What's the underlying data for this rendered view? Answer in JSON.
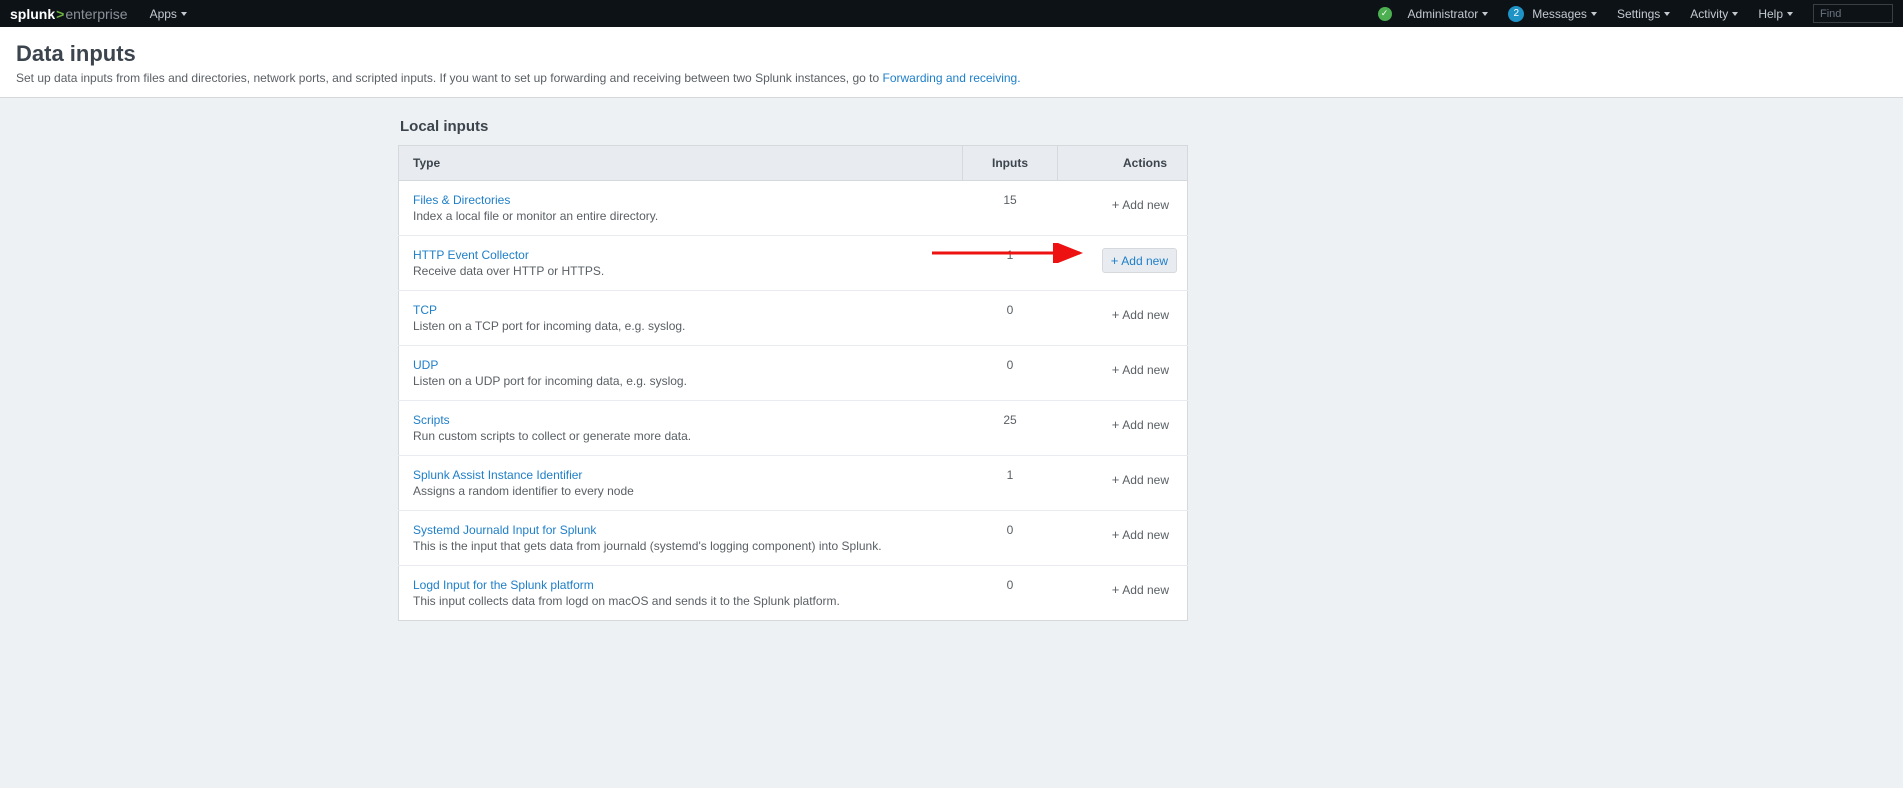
{
  "topbar": {
    "logo_part1": "splunk",
    "logo_part2": "enterprise",
    "apps": "Apps",
    "administrator": "Administrator",
    "messages_label": "Messages",
    "messages_count": "2",
    "settings": "Settings",
    "activity": "Activity",
    "help": "Help",
    "find_placeholder": "Find"
  },
  "header": {
    "title": "Data inputs",
    "subtitle_prefix": "Set up data inputs from files and directories, network ports, and scripted inputs. If you want to set up forwarding and receiving between two Splunk instances, go to ",
    "subtitle_link": "Forwarding and receiving."
  },
  "section": {
    "title": "Local inputs"
  },
  "columns": {
    "type": "Type",
    "inputs": "Inputs",
    "actions": "Actions"
  },
  "add_new_label": "Add new",
  "rows": [
    {
      "name": "Files & Directories",
      "desc": "Index a local file or monitor an entire directory.",
      "count": "15",
      "highlighted": false
    },
    {
      "name": "HTTP Event Collector",
      "desc": "Receive data over HTTP or HTTPS.",
      "count": "1",
      "highlighted": true
    },
    {
      "name": "TCP",
      "desc": "Listen on a TCP port for incoming data, e.g. syslog.",
      "count": "0",
      "highlighted": false
    },
    {
      "name": "UDP",
      "desc": "Listen on a UDP port for incoming data, e.g. syslog.",
      "count": "0",
      "highlighted": false
    },
    {
      "name": "Scripts",
      "desc": "Run custom scripts to collect or generate more data.",
      "count": "25",
      "highlighted": false
    },
    {
      "name": "Splunk Assist Instance Identifier",
      "desc": "Assigns a random identifier to every node",
      "count": "1",
      "highlighted": false
    },
    {
      "name": "Systemd Journald Input for Splunk",
      "desc": "This is the input that gets data from journald (systemd's logging component) into Splunk.",
      "count": "0",
      "highlighted": false
    },
    {
      "name": "Logd Input for the Splunk platform",
      "desc": "This input collects data from logd on macOS and sends it to the Splunk platform.",
      "count": "0",
      "highlighted": false
    }
  ]
}
